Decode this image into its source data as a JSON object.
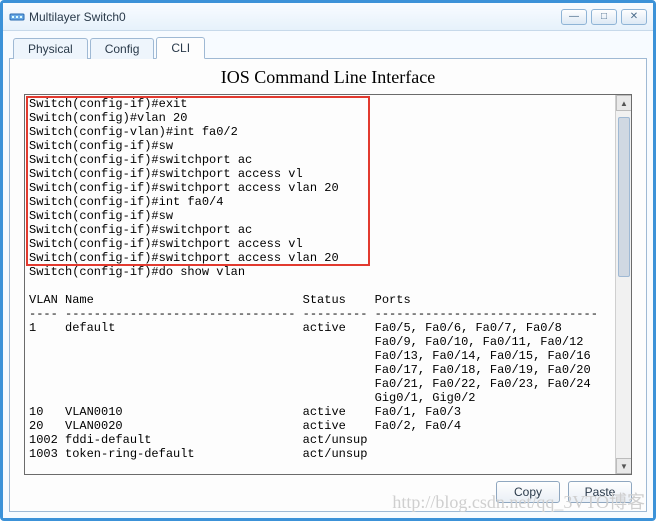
{
  "window": {
    "title": "Multilayer Switch0",
    "minimize": "—",
    "maximize": "□",
    "close": "✕"
  },
  "tabs": [
    {
      "label": "Physical",
      "active": false
    },
    {
      "label": "Config",
      "active": false
    },
    {
      "label": "CLI",
      "active": true
    }
  ],
  "panel": {
    "title": "IOS Command Line Interface"
  },
  "highlighted_cli": [
    "Switch(config-if)#exit",
    "Switch(config)#vlan 20",
    "Switch(config-vlan)#int fa0/2",
    "Switch(config-if)#sw",
    "Switch(config-if)#switchport ac",
    "Switch(config-if)#switchport access vl",
    "Switch(config-if)#switchport access vlan 20",
    "Switch(config-if)#int fa0/4",
    "Switch(config-if)#sw",
    "Switch(config-if)#switchport ac",
    "Switch(config-if)#switchport access vl",
    "Switch(config-if)#switchport access vlan 20"
  ],
  "unhighlighted_cli": [
    "Switch(config-if)#do show vlan",
    ""
  ],
  "vlan_table": {
    "header": "VLAN Name                             Status    Ports",
    "divider": "---- -------------------------------- --------- -------------------------------",
    "rows": [
      {
        "id": "1",
        "name": "default",
        "status": "active",
        "ports": [
          "Fa0/5, Fa0/6, Fa0/7, Fa0/8",
          "Fa0/9, Fa0/10, Fa0/11, Fa0/12",
          "Fa0/13, Fa0/14, Fa0/15, Fa0/16",
          "Fa0/17, Fa0/18, Fa0/19, Fa0/20",
          "Fa0/21, Fa0/22, Fa0/23, Fa0/24",
          "Gig0/1, Gig0/2"
        ]
      },
      {
        "id": "10",
        "name": "VLAN0010",
        "status": "active",
        "ports": [
          "Fa0/1, Fa0/3"
        ]
      },
      {
        "id": "20",
        "name": "VLAN0020",
        "status": "active",
        "ports": [
          "Fa0/2, Fa0/4"
        ]
      },
      {
        "id": "1002",
        "name": "fddi-default",
        "status": "act/unsup",
        "ports": []
      },
      {
        "id": "1003",
        "name": "token-ring-default",
        "status": "act/unsup",
        "ports": []
      }
    ]
  },
  "buttons": {
    "copy": "Copy",
    "paste": "Paste"
  },
  "watermark": "http://blog.csdn.net/qq_3VTO博客"
}
